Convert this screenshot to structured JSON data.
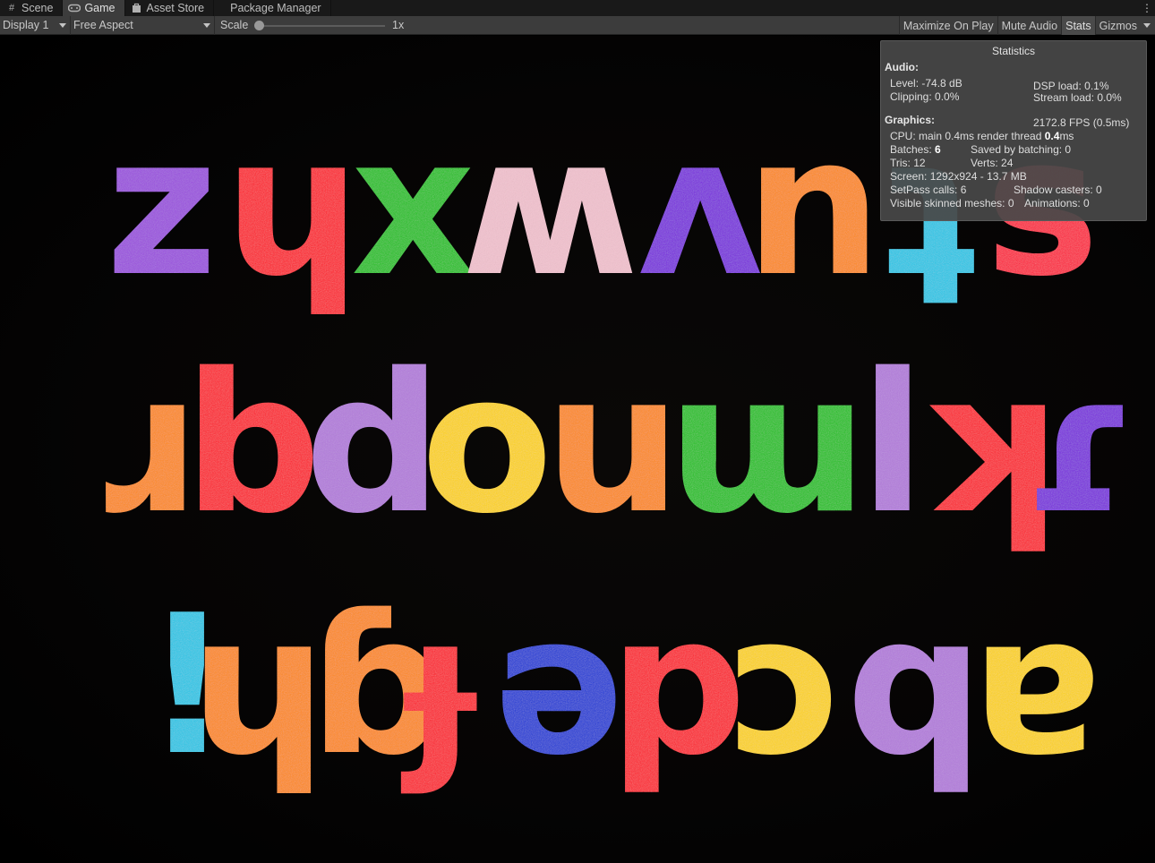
{
  "tabs": [
    {
      "label": "Scene",
      "icon": "hash-icon",
      "active": false
    },
    {
      "label": "Game",
      "icon": "gamepad-icon",
      "active": true
    },
    {
      "label": "Asset Store",
      "icon": "store-bag-icon",
      "active": false
    },
    {
      "label": "Package Manager",
      "icon": "",
      "active": false
    }
  ],
  "toolbar": {
    "display": "Display 1",
    "aspect": "Free Aspect",
    "scale_label": "Scale",
    "scale_value": "1x",
    "scale_fraction": 0.0,
    "maximize": "Maximize On Play",
    "mute": "Mute Audio",
    "stats": "Stats",
    "gizmos": "Gizmos"
  },
  "statistics": {
    "title": "Statistics",
    "audio_header": "Audio:",
    "level": "Level: -74.8 dB",
    "dsp": "DSP load: 0.1%",
    "clipping": "Clipping: 0.0%",
    "stream": "Stream load: 0.0%",
    "graphics_header": "Graphics:",
    "fps": "2172.8 FPS (0.5ms)",
    "cpu_prefix": "CPU: main 0.4ms  render thread ",
    "cpu_bold": "0.4",
    "cpu_suffix": "ms",
    "batches_prefix": "Batches: ",
    "batches_bold": "6",
    "saved": "Saved by batching: 0",
    "tris": "Tris: 12",
    "verts": "Verts: 24",
    "screen": "Screen: 1292x924 - 13.7 MB",
    "setpass": "SetPass calls: 6",
    "shadow": "Shadow casters: 0",
    "skinned": "Visible skinned meshes: 0",
    "animations": "Animations: 0"
  },
  "game_view": {
    "row1": "zhxmʌnʇs",
    "row2": "ɹbdounɯlʞ",
    "row3": "!ɥɓɟəpɔqɐ",
    "colors": {
      "purple": "#9b4fe0",
      "red": "#ff1a2a",
      "green": "#1fc21f",
      "pink": "#f3c2cf",
      "violet": "#7a2adf",
      "orange": "#ff8a12",
      "cyan": "#22c8e8",
      "lavender": "#b47bdd",
      "yellow": "#ffd400",
      "blue": "#1a3ad8",
      "crimson": "#ff2040"
    }
  }
}
